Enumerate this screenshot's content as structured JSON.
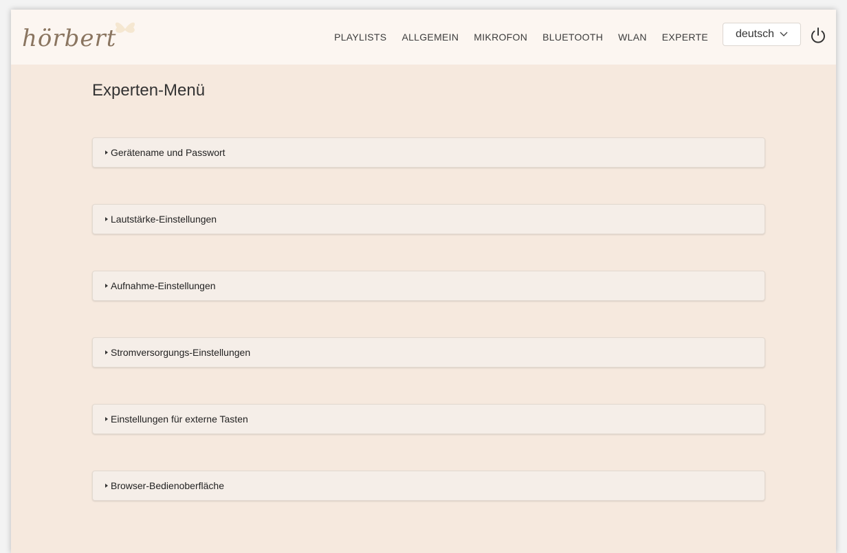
{
  "logo": {
    "text": "hörbert"
  },
  "nav": {
    "links": [
      "PLAYLISTS",
      "ALLGEMEIN",
      "MIKROFON",
      "BLUETOOTH",
      "WLAN",
      "EXPERTE"
    ],
    "language": "deutsch",
    "power_icon": "power-icon"
  },
  "main": {
    "title": "Experten-Menü",
    "sections": [
      {
        "label": "Gerätename und Passwort"
      },
      {
        "label": "Lautstärke-Einstellungen"
      },
      {
        "label": "Aufnahme-Einstellungen"
      },
      {
        "label": "Stromversorgungs-Einstellungen"
      },
      {
        "label": "Einstellungen für externe Tasten"
      },
      {
        "label": "Browser-Bedienoberfläche"
      }
    ]
  },
  "colors": {
    "background": "#f6e9de",
    "navbar": "#fcf6f1",
    "logo": "#8a7560"
  }
}
